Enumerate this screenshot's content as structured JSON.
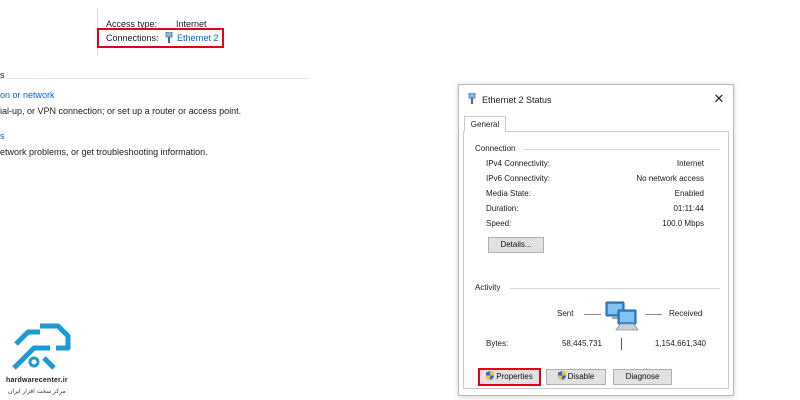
{
  "background": {
    "access_type_label": "Access type:",
    "access_type_value": "Internet",
    "connections_label": "Connections:",
    "connections_link": "Ethernet 2",
    "fragment_heading": "s",
    "fragment_link_1": "on or network",
    "fragment_text_1": "ial-up, or VPN connection; or set up a router or access point.",
    "fragment_link_2": "s",
    "fragment_text_2": "etwork problems, or get troubleshooting information."
  },
  "dialog": {
    "title": "Ethernet 2 Status",
    "close_glyph": "✕",
    "tab_label": "General",
    "connection": {
      "group_label": "Connection",
      "rows": [
        {
          "label": "IPv4 Connectivity:",
          "value": "Internet"
        },
        {
          "label": "IPv6 Connectivity:",
          "value": "No network access"
        },
        {
          "label": "Media State:",
          "value": "Enabled"
        },
        {
          "label": "Duration:",
          "value": "01:11:44"
        },
        {
          "label": "Speed:",
          "value": "100.0 Mbps"
        }
      ],
      "details_button": "Details..."
    },
    "activity": {
      "group_label": "Activity",
      "sent_label": "Sent",
      "received_label": "Received",
      "bytes_label": "Bytes:",
      "bytes_sent": "58,445,731",
      "bytes_received": "1,154,661,340"
    },
    "buttons": {
      "properties": "Properties",
      "disable": "Disable",
      "diagnose": "Diagnose"
    }
  },
  "logo": {
    "text_en": "hardwarecenter.ir",
    "text_fa": "مرکز سخت افزار ایران"
  },
  "colors": {
    "highlight_red": "#e2001a",
    "link_blue": "#0b63c5",
    "logo_blue": "#1a9ad6"
  }
}
